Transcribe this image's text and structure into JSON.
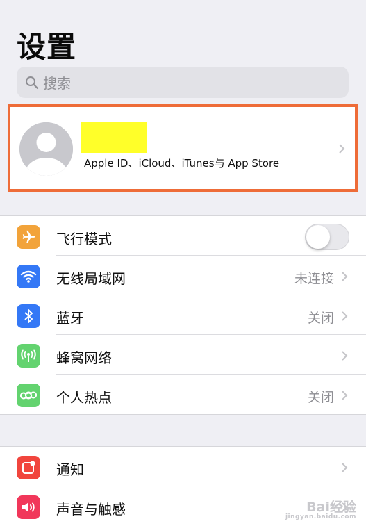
{
  "header": {
    "title": "设置"
  },
  "search": {
    "placeholder": "搜索",
    "icon": "search-icon"
  },
  "profile": {
    "subtitle": "Apple ID、iCloud、iTunes与 App Store",
    "highlight_color": "#ee6c38",
    "redaction_color": "#ffff29"
  },
  "connectivity": [
    {
      "label": "飞行模式",
      "icon": "airplane-icon",
      "color": "#f2a33a",
      "toggle": false
    },
    {
      "label": "无线局域网",
      "icon": "wifi-icon",
      "color": "#3478f6",
      "value": "未连接"
    },
    {
      "label": "蓝牙",
      "icon": "bluetooth-icon",
      "color": "#3478f6",
      "value": "关闭"
    },
    {
      "label": "蜂窝网络",
      "icon": "cellular-icon",
      "color": "#63d36f",
      "value": ""
    },
    {
      "label": "个人热点",
      "icon": "hotspot-icon",
      "color": "#63d36f",
      "value": "关闭"
    }
  ],
  "notifications": [
    {
      "label": "通知",
      "icon": "notifications-icon",
      "color": "#f1453d"
    },
    {
      "label": "声音与触感",
      "icon": "sounds-icon",
      "color": "#f1375a"
    }
  ],
  "watermark": {
    "text": "Bai经验",
    "sub": "jingyan.baidu.com"
  }
}
